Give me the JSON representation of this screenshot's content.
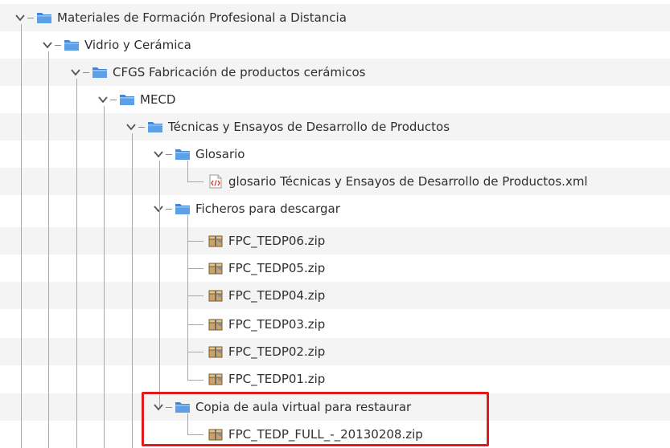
{
  "tree": {
    "nodes": [
      {
        "label": "Materiales de Formación Profesional a Distancia",
        "type": "folder",
        "expanded": true
      },
      {
        "label": "Vidrio y Cerámica",
        "type": "folder",
        "expanded": true
      },
      {
        "label": "CFGS Fabricación de productos cerámicos",
        "type": "folder",
        "expanded": true
      },
      {
        "label": "MECD",
        "type": "folder",
        "expanded": true
      },
      {
        "label": "Técnicas y Ensayos de Desarrollo de Productos",
        "type": "folder",
        "expanded": true
      },
      {
        "label": "Glosario",
        "type": "folder",
        "expanded": true
      },
      {
        "label": "glosario Técnicas y Ensayos de Desarrollo de Productos.xml",
        "type": "xml"
      },
      {
        "label": "Ficheros para descargar",
        "type": "folder",
        "expanded": true
      },
      {
        "label": "FPC_TEDP06.zip",
        "type": "zip"
      },
      {
        "label": "FPC_TEDP05.zip",
        "type": "zip"
      },
      {
        "label": "FPC_TEDP04.zip",
        "type": "zip"
      },
      {
        "label": "FPC_TEDP03.zip",
        "type": "zip"
      },
      {
        "label": "FPC_TEDP02.zip",
        "type": "zip"
      },
      {
        "label": "FPC_TEDP01.zip",
        "type": "zip"
      },
      {
        "label": "Copia de aula virtual para restaurar",
        "type": "folder",
        "expanded": true
      },
      {
        "label": "FPC_TEDP_FULL_-_20130208.zip",
        "type": "zip"
      }
    ]
  },
  "colors": {
    "highlight": "#e01b1b",
    "folder": "#3f87d6",
    "row_alt": "#f4f4f4"
  },
  "icons": {
    "expander": "chevron-down-icon",
    "folder": "folder-icon",
    "xml": "xml-file-icon",
    "zip": "zip-archive-icon"
  }
}
